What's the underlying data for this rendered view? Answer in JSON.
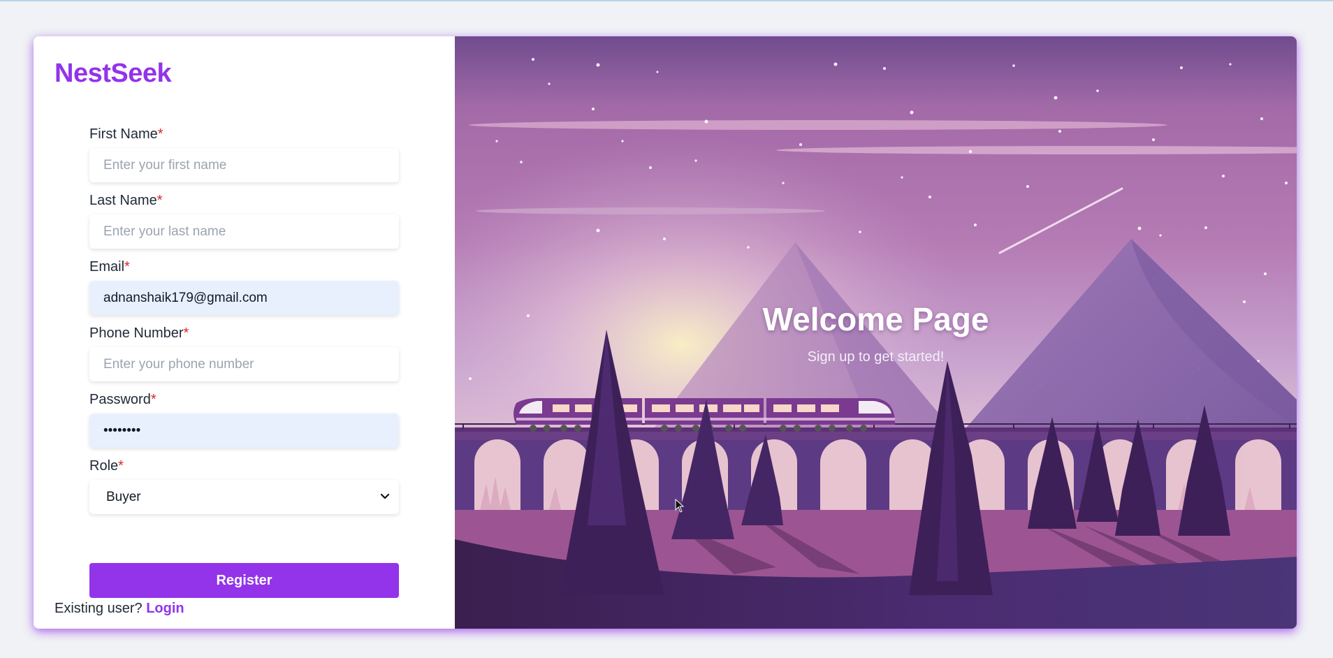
{
  "brand": {
    "name": "NestSeek"
  },
  "form": {
    "first_name": {
      "label": "First Name",
      "required_mark": "*",
      "placeholder": "Enter your first name",
      "value": ""
    },
    "last_name": {
      "label": "Last Name",
      "required_mark": "*",
      "placeholder": "Enter your last name",
      "value": ""
    },
    "email": {
      "label": "Email",
      "required_mark": "*",
      "value": "adnanshaik179@gmail.com"
    },
    "phone": {
      "label": "Phone Number",
      "required_mark": "*",
      "placeholder": "Enter your phone number",
      "value": ""
    },
    "password": {
      "label": "Password",
      "required_mark": "*",
      "value": "••••••••"
    },
    "role": {
      "label": "Role",
      "required_mark": "*",
      "selected": "Buyer"
    },
    "register_label": "Register"
  },
  "footer": {
    "prompt": "Existing user?",
    "login_link": "Login"
  },
  "hero": {
    "title": "Welcome Page",
    "subtitle": "Sign up to get started!"
  },
  "colors": {
    "accent": "#9333ea",
    "required": "#dc2626",
    "autofill_bg": "#e8f0fe",
    "page_bg": "#f0f2f5"
  },
  "icons": [
    "chevron-down-icon",
    "mouse-cursor-icon"
  ]
}
